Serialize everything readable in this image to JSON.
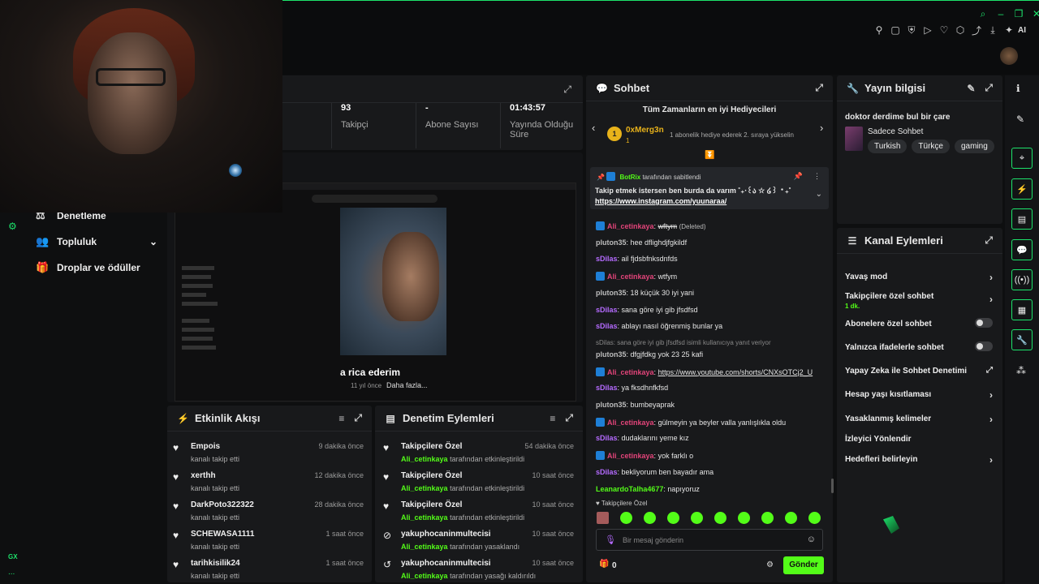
{
  "topbar": {
    "icons_right_top": [
      "search-icon",
      "minimize-icon",
      "restore-icon",
      "close-icon"
    ],
    "icons_toolbar": [
      "pin-icon",
      "crop-icon",
      "shield-icon",
      "play-icon",
      "heart-icon",
      "extension-icon",
      "share-icon",
      "download-icon",
      "wand-icon"
    ],
    "ai_label": "AI",
    "more": "⋮"
  },
  "leftnav": {
    "items": [
      {
        "label": "Denetleme",
        "icon": "gavel-icon"
      },
      {
        "label": "Topluluk",
        "icon": "community-icon",
        "chevron": "⌄"
      },
      {
        "label": "Droplar ve ödüller",
        "icon": "gift-icon"
      }
    ],
    "bottom": [
      "GX",
      "..."
    ]
  },
  "stream_stats": [
    {
      "value": "93",
      "label": "Takipçi"
    },
    {
      "value": "-",
      "label": "Abone Sayısı"
    },
    {
      "value": "01:43:57",
      "label": "Yayında Olduğu Süre"
    }
  ],
  "video_overlay": {
    "caption": "a rica ederim",
    "meta_time": "11 yıl önce",
    "more": "Daha fazla..."
  },
  "chat": {
    "title": "Sohbet",
    "top_gifters_title": "Tüm Zamanların en iyi Hediyecileri",
    "gifter": {
      "rank": "1",
      "name": "0xMerg3n",
      "count": "1",
      "note": "1 abonelik hediye ederek 2. sıraya yükselin"
    },
    "pinned": {
      "by_user": "BotRix",
      "by_suffix": "tarafından sabitlendi",
      "text": "Takip etmek istersen ben burda da varım ˚₊‧꒰ა ☆ ໒꒱ ‧₊˚",
      "link": "https://www.instagram.com/yuunaraa/"
    },
    "messages": [
      {
        "user": "Ali_cetinkaya",
        "color": "red",
        "badge": true,
        "text": "wftym",
        "deleted": "(Deleted)"
      },
      {
        "user": "pluton35",
        "color": "gray",
        "text": "hee dflighdjfgkildf"
      },
      {
        "user": "sDilas",
        "color": "purple",
        "text": "ail fjdsbfnksdnfds"
      },
      {
        "user": "Ali_cetinkaya",
        "color": "red",
        "badge": true,
        "text": "wtfym"
      },
      {
        "user": "pluton35",
        "color": "gray",
        "text": "18 küçük 30 iyi yani"
      },
      {
        "user": "sDilas",
        "color": "purple",
        "text": "sana göre iyi gib jfsdfsd"
      },
      {
        "user": "sDilas",
        "color": "purple",
        "text": "ablayı nasıl öğrenmiş bunlar ya"
      },
      {
        "reply": "sDilas: sana göre iyi gib jfsdfsd isimli kullanıcıya yanıt veriyor",
        "user": "pluton35",
        "color": "gray",
        "text": "dfgjfdkg yok 23 25 kafi"
      },
      {
        "user": "Ali_cetinkaya",
        "color": "red",
        "badge": true,
        "text": "https://www.youtube.com/shorts/CNXsOTCj2_U",
        "link": true
      },
      {
        "user": "sDilas",
        "color": "purple",
        "text": "ya fksdhnfkfsd"
      },
      {
        "user": "pluton35",
        "color": "gray",
        "text": "bumbeyaprak"
      },
      {
        "user": "Ali_cetinkaya",
        "color": "red",
        "badge": true,
        "text": "gülmeyin ya beyler valla yanlışlıkla oldu"
      },
      {
        "user": "sDilas",
        "color": "purple",
        "text": "dudaklarını yeme kız"
      },
      {
        "user": "Ali_cetinkaya",
        "color": "red",
        "badge": true,
        "text": "yok farklı o"
      },
      {
        "user": "sDilas",
        "color": "purple",
        "text": "bekliyorum ben bayadır ama"
      },
      {
        "user": "LeanardoTalha4677",
        "color": "green",
        "text": "napıyoruz"
      }
    ],
    "follower_only_label": "Takipçilere Özel",
    "input_placeholder": "Bir mesaj gönderin",
    "points": "0",
    "send": "Gönder"
  },
  "stream_info": {
    "title": "Yayın bilgisi",
    "stream_title": "doktor derdime bul bir çare",
    "category": "Sadece Sohbet",
    "tags": [
      "Turkish",
      "Türkçe",
      "gaming"
    ]
  },
  "channel_actions": {
    "title": "Kanal Eylemleri",
    "items": [
      {
        "label": "Yavaş mod",
        "type": "chevron"
      },
      {
        "label": "Takipçilere özel sohbet",
        "sub": "1 dk.",
        "type": "chevron"
      },
      {
        "label": "Abonelere özel sohbet",
        "type": "toggle"
      },
      {
        "label": "Yalnızca ifadelerle sohbet",
        "type": "toggle"
      },
      {
        "label": "Yapay Zeka ile Sohbet Denetimi",
        "type": "external"
      },
      {
        "label": "Hesap yaşı kısıtlaması",
        "type": "chevron"
      },
      {
        "label": "Yasaklanmış kelimeler",
        "type": "chevron"
      },
      {
        "label": "İzleyici Yönlendir",
        "type": "none"
      },
      {
        "label": "Hedefleri belirleyin",
        "type": "chevron"
      }
    ]
  },
  "activity_feed": {
    "title": "Etkinlik Akışı",
    "items": [
      {
        "name": "Empois",
        "desc": "kanalı takip etti",
        "time": "9 dakika önce"
      },
      {
        "name": "xerthh",
        "desc": "kanalı takip etti",
        "time": "12 dakika önce"
      },
      {
        "name": "DarkPoto322322",
        "desc": "kanalı takip etti",
        "time": "28 dakika önce"
      },
      {
        "name": "SCHEWASA1111",
        "desc": "kanalı takip etti",
        "time": "1 saat önce"
      },
      {
        "name": "tarihkisilik24",
        "desc": "kanalı takip etti",
        "time": "1 saat önce"
      }
    ]
  },
  "mod_actions": {
    "title": "Denetim Eylemleri",
    "items": [
      {
        "name": "Takipçilere Özel",
        "by": "Ali_cetinkaya",
        "desc": "tarafından etkinleştirildi",
        "time": "54 dakika önce",
        "icon": "heart-icon"
      },
      {
        "name": "Takipçilere Özel",
        "by": "Ali_cetinkaya",
        "desc": "tarafından etkinleştirildi",
        "time": "10 saat önce",
        "icon": "heart-icon"
      },
      {
        "name": "Takipçilere Özel",
        "by": "Ali_cetinkaya",
        "desc": "tarafından etkinleştirildi",
        "time": "10 saat önce",
        "icon": "heart-icon"
      },
      {
        "name": "yakuphocaninmultecisi",
        "by": "Ali_cetinkaya",
        "desc": "tarafından yasaklandı",
        "time": "10 saat önce",
        "icon": "ban-icon"
      },
      {
        "name": "yakuphocaninmultecisi",
        "by": "Ali_cetinkaya",
        "desc": "tarafından yasağı kaldırıldı",
        "time": "10 saat önce",
        "icon": "undo-icon"
      }
    ]
  },
  "colors": {
    "accent": "#53fc18",
    "purple": "#b56bff",
    "red": "#e3447a",
    "panel": "#18191b"
  }
}
